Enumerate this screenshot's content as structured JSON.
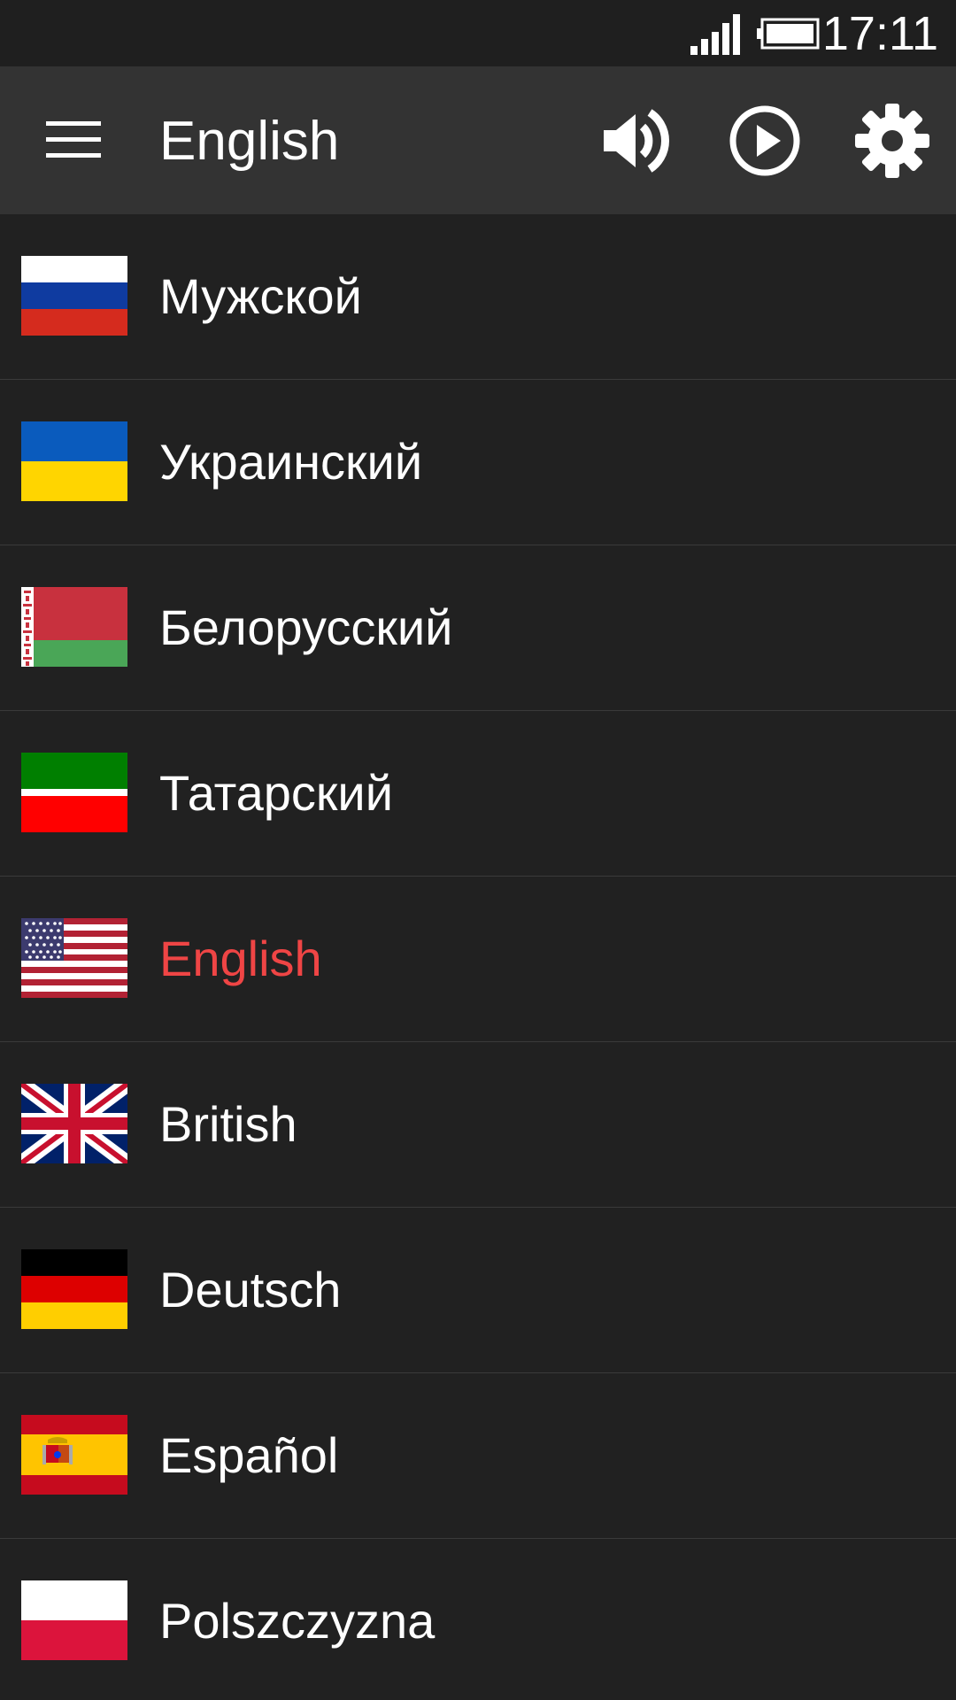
{
  "status_bar": {
    "time": "17:11",
    "icons": [
      "signal-icon",
      "battery-icon"
    ]
  },
  "toolbar": {
    "title": "English",
    "icons": [
      "menu-icon",
      "volume-icon",
      "play-icon",
      "settings-icon"
    ]
  },
  "languages": [
    {
      "label": "Мужской",
      "flag": "russia-flag-icon",
      "selected": false
    },
    {
      "label": "Украинский",
      "flag": "ukraine-flag-icon",
      "selected": false
    },
    {
      "label": "Белорусский",
      "flag": "belarus-flag-icon",
      "selected": false
    },
    {
      "label": "Татарский",
      "flag": "tatarstan-flag-icon",
      "selected": false
    },
    {
      "label": "English",
      "flag": "usa-flag-icon",
      "selected": true
    },
    {
      "label": "British",
      "flag": "uk-flag-icon",
      "selected": false
    },
    {
      "label": "Deutsch",
      "flag": "germany-flag-icon",
      "selected": false
    },
    {
      "label": "Español",
      "flag": "spain-flag-icon",
      "selected": false
    },
    {
      "label": "Polszczyzna",
      "flag": "poland-flag-icon",
      "selected": false
    }
  ],
  "colors": {
    "background": "#212121",
    "toolbar": "#333333",
    "status_bar": "#1f1f1f",
    "selected_text": "#ef4545",
    "divider": "#3a3a3a"
  }
}
